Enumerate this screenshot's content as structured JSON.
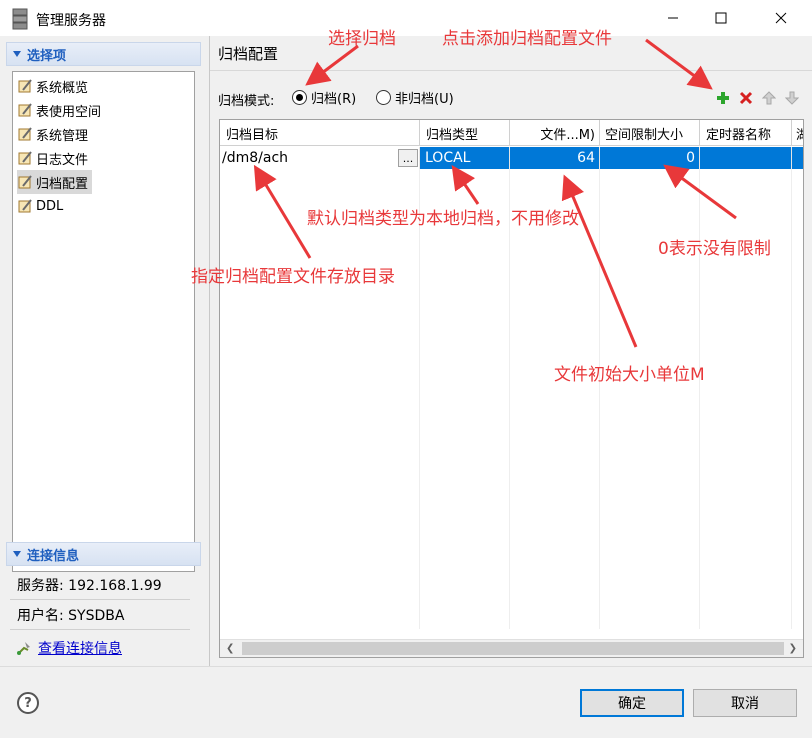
{
  "window": {
    "title": "管理服务器"
  },
  "sidebar": {
    "options_header": "选择项",
    "items": [
      {
        "label": "系统概览",
        "selected": false
      },
      {
        "label": "表使用空间",
        "selected": false
      },
      {
        "label": "系统管理",
        "selected": false
      },
      {
        "label": "日志文件",
        "selected": false
      },
      {
        "label": "归档配置",
        "selected": true
      },
      {
        "label": "DDL",
        "selected": false
      }
    ],
    "connection_header": "连接信息",
    "server": "服务器: 192.168.1.99",
    "user": "用户名: SYSDBA",
    "view_link": "查看连接信息"
  },
  "main": {
    "title": "归档配置",
    "mode_label": "归档模式:",
    "radio_archive": {
      "label": "归档(R)",
      "checked": true
    },
    "radio_noarchive": {
      "label": "非归档(U)",
      "checked": false
    },
    "toolbar": {
      "add_icon": "plus-icon",
      "delete_icon": "x-icon",
      "up_icon": "arrow-up-icon",
      "down_icon": "arrow-down-icon"
    },
    "table": {
      "columns": [
        "归档目标",
        "归档类型",
        "文件...M)",
        "空间限制大小",
        "定时器名称",
        "湖"
      ],
      "rows": [
        {
          "dest": "/dm8/ach",
          "browse": "...",
          "type": "LOCAL",
          "file_size": "64",
          "space_limit": "0",
          "timer": ""
        }
      ]
    }
  },
  "footer": {
    "help": "?",
    "ok": "确定",
    "cancel": "取消"
  },
  "annotations": {
    "select_archive": "选择归档",
    "add_file": "点击添加归档配置文件",
    "default_type": "默认归档类型为本地归档，不用修改",
    "zero_no_limit": "0表示没有限制",
    "dir_hint": "指定归档配置文件存放目录",
    "size_unit": "文件初始大小单位M"
  },
  "colors": {
    "selection": "#0078d7",
    "annotation": "#e8383a",
    "section_header": "#1f5fbf"
  }
}
